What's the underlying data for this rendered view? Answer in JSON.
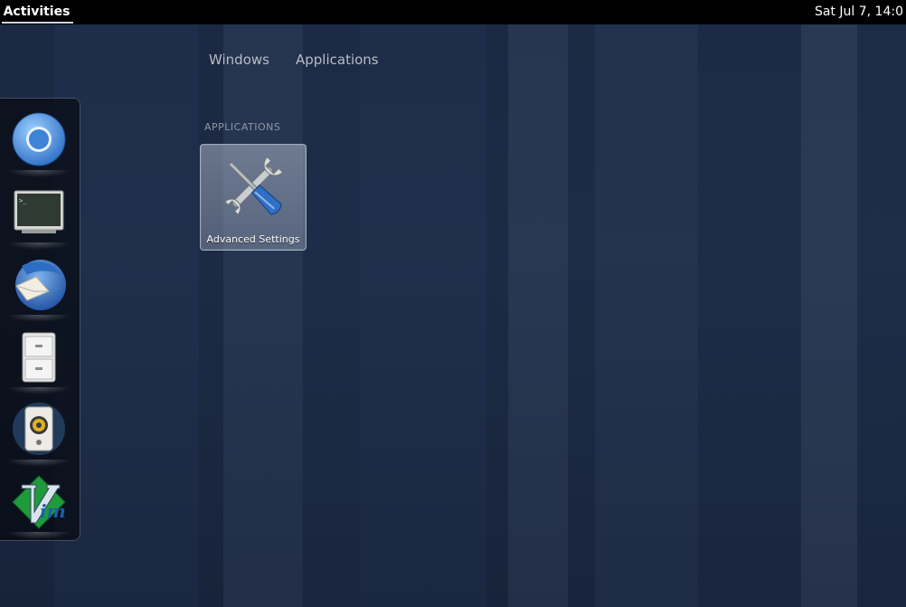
{
  "topbar": {
    "activities_label": "Activities",
    "clock": "Sat Jul  7, 14:0"
  },
  "dash": {
    "items": [
      {
        "name": "Chromium Web Browser",
        "icon": "chromium-icon"
      },
      {
        "name": "Terminal",
        "icon": "terminal-icon"
      },
      {
        "name": "Thunderbird Mail",
        "icon": "thunderbird-icon"
      },
      {
        "name": "Files",
        "icon": "file-cabinet-icon"
      },
      {
        "name": "Rhythmbox",
        "icon": "speaker-icon"
      },
      {
        "name": "Vim",
        "icon": "vim-icon"
      }
    ]
  },
  "views": {
    "windows_label": "Windows",
    "applications_label": "Applications"
  },
  "results": {
    "heading": "APPLICATIONS",
    "apps": [
      {
        "label": "Advanced Settings",
        "icon": "wrench-screwdriver-icon"
      }
    ]
  },
  "colors": {
    "topbar": "#000000",
    "desktop": "#1e2d4a",
    "accent_blue": "#3a7bd5"
  }
}
